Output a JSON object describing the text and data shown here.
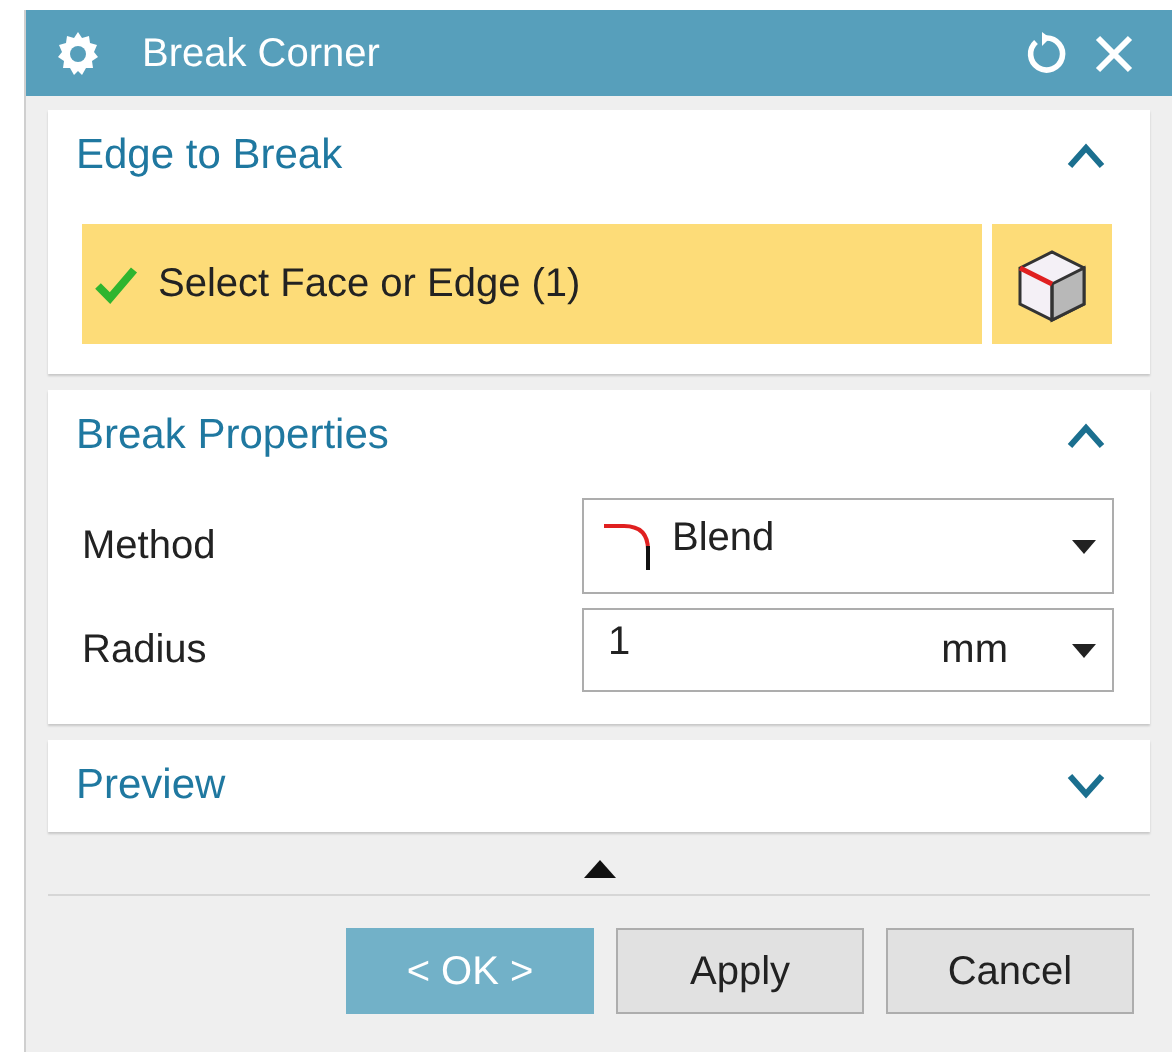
{
  "window": {
    "title": "Break Corner"
  },
  "sections": [
    {
      "title": "Edge to Break",
      "expanded": true,
      "selection": {
        "label": "Select Face or Edge (1)",
        "complete": true
      }
    },
    {
      "title": "Break Properties",
      "expanded": true,
      "fields": [
        {
          "kind": "dropdown",
          "label": "Method",
          "value": "Blend"
        },
        {
          "kind": "unit",
          "label": "Radius",
          "value": "1",
          "unit": "mm"
        }
      ]
    },
    {
      "title": "Preview",
      "expanded": false
    }
  ],
  "more_options": {
    "expanded": false
  },
  "buttons": [
    {
      "label": "< OK >",
      "default": true
    },
    {
      "label": "Apply",
      "default": false
    },
    {
      "label": "Cancel",
      "default": false
    }
  ]
}
